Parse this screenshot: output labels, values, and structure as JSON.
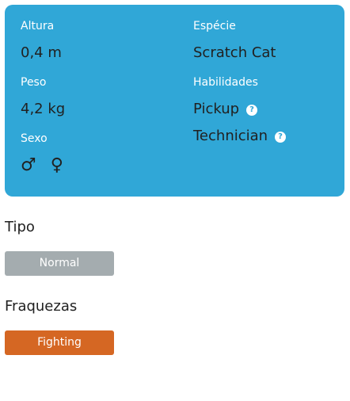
{
  "profile": {
    "height_label": "Altura",
    "height_value": "0,4 m",
    "weight_label": "Peso",
    "weight_value": "4,2 kg",
    "gender_label": "Sexo",
    "gender_icons": [
      "male-icon",
      "female-icon"
    ],
    "category_label": "Espécie",
    "category_value": "Scratch Cat",
    "abilities_label": "Habilidades",
    "abilities": [
      {
        "name": "Pickup",
        "icon": "question-mark-icon"
      },
      {
        "name": "Technician",
        "icon": "question-mark-icon"
      }
    ]
  },
  "type_section": {
    "title": "Tipo",
    "types": [
      {
        "name": "Normal",
        "color": "#a4acaf"
      }
    ]
  },
  "weakness_section": {
    "title": "Fraquezas",
    "types": [
      {
        "name": "Fighting",
        "color": "#d56723"
      }
    ]
  },
  "colors": {
    "card": "#30a7d7"
  }
}
